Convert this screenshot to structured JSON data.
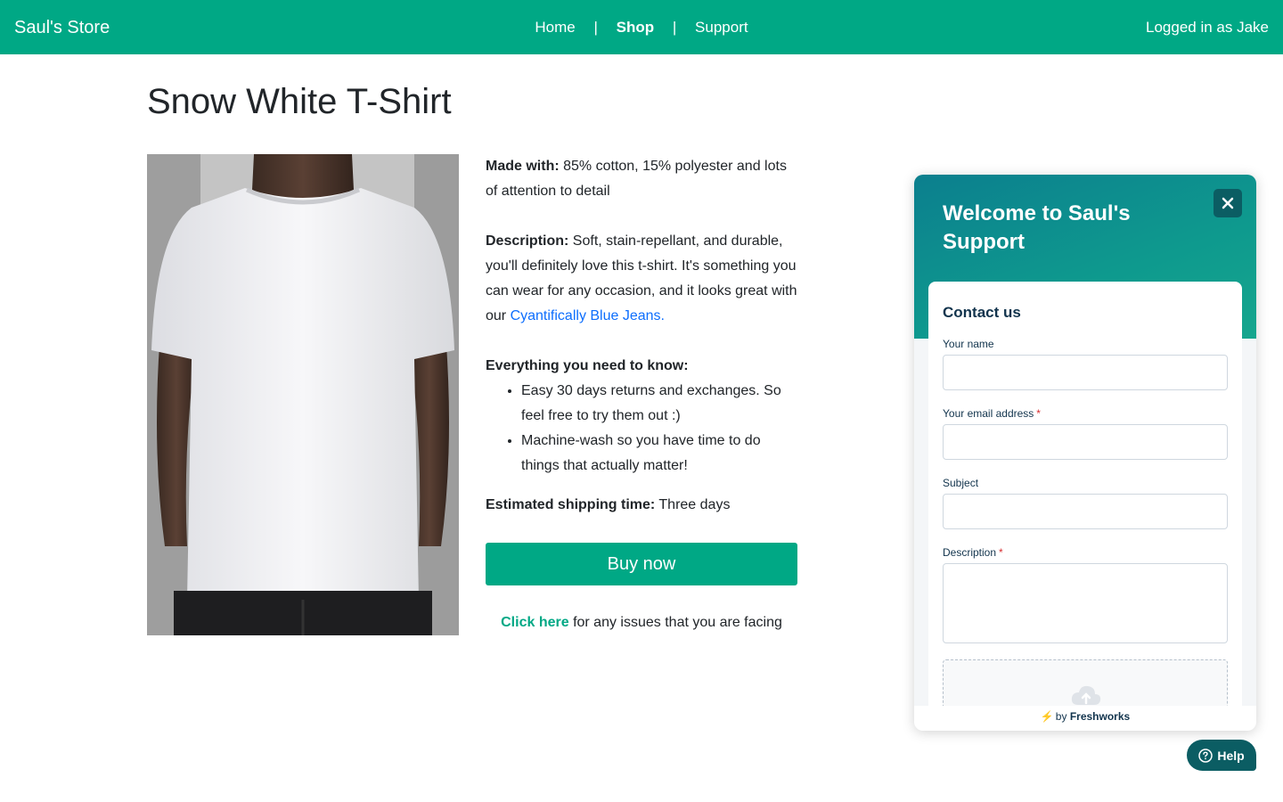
{
  "nav": {
    "brand": "Saul's Store",
    "links": [
      "Home",
      "Shop",
      "Support"
    ],
    "separator": "|",
    "user": "Logged in as Jake"
  },
  "product": {
    "title": "Snow White T-Shirt",
    "made_with_label": "Made with:",
    "made_with_text": "85% cotton, 15% polyester and lots of attention to detail",
    "description_label": "Description:",
    "description_text": "Soft, stain-repellant, and durable, you'll definitely love this t-shirt. It's something you can wear for any occasion, and it looks great with our",
    "jeans_link": "Cyantifically Blue Jeans.",
    "know_label": "Everything you need to know:",
    "bullets": [
      "Easy 30 days returns and exchanges. So feel free to try them out :)",
      "Machine-wash so you have time to do things that actually matter!"
    ],
    "shipping_label": "Estimated shipping time:",
    "shipping_value": "Three days",
    "buy_label": "Buy now",
    "issues_link": "Click here",
    "issues_text": "for any issues that you are facing"
  },
  "widget": {
    "welcome": "Welcome to Saul's Support",
    "contact_title": "Contact us",
    "fields": {
      "name_label": "Your name",
      "email_label": "Your email address",
      "subject_label": "Subject",
      "description_label": "Description",
      "required_mark": "*"
    },
    "footer_by": "by",
    "footer_brand": "Freshworks",
    "help_label": "Help"
  },
  "colors": {
    "brand": "#00a885",
    "link": "#0d6efd",
    "widget_dark": "#0b5d63",
    "required": "#d72d30"
  },
  "icons": {
    "close": "close-icon",
    "upload": "cloud-upload-icon",
    "help": "question-circle-icon",
    "bolt": "lightning-icon"
  }
}
